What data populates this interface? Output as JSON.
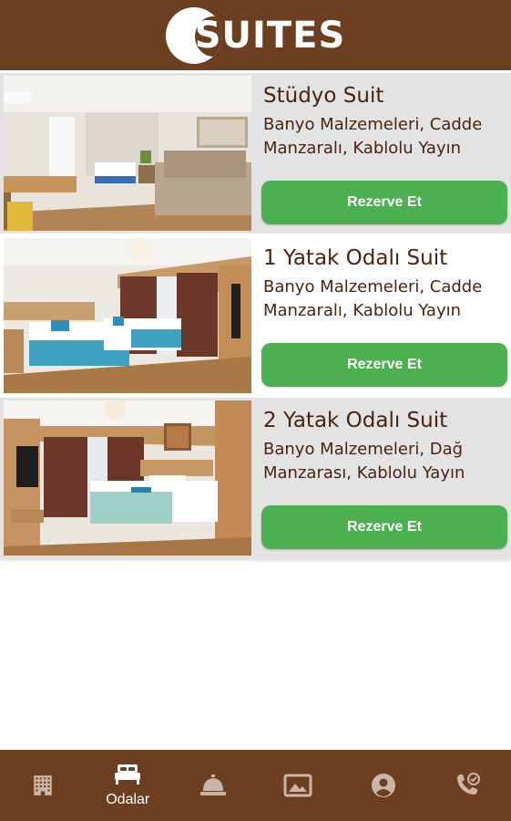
{
  "header": {
    "logo_text": "SUITES"
  },
  "rooms": [
    {
      "title": "Stüdyo Suit",
      "description": "Banyo Malzemeleri, Cadde Manzaralı, Kablolu Yayın",
      "button": "Rezerve Et"
    },
    {
      "title": "1 Yatak Odalı Suit",
      "description": "Banyo Malzemeleri, Cadde Manzaralı, Kablolu Yayın",
      "button": "Rezerve Et"
    },
    {
      "title": "2 Yatak Odalı Suit",
      "description": "Banyo Malzemeleri, Dağ Manzarası, Kablolu Yayın",
      "button": "Rezerve Et"
    }
  ],
  "bottom_nav": {
    "items": [
      {
        "icon": "building-icon",
        "label": ""
      },
      {
        "icon": "bed-icon",
        "label": "Odalar"
      },
      {
        "icon": "reception-bell-icon",
        "label": ""
      },
      {
        "icon": "gallery-icon",
        "label": ""
      },
      {
        "icon": "account-icon",
        "label": ""
      },
      {
        "icon": "contact-phone-icon",
        "label": ""
      }
    ]
  },
  "colors": {
    "brand": "#6b3f20",
    "button": "#4caf50",
    "text": "#4a2410"
  }
}
